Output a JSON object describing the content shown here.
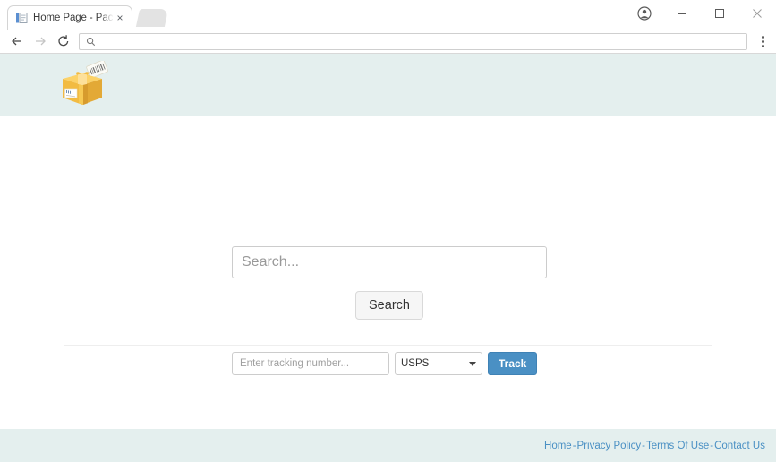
{
  "browser": {
    "tabs": [
      {
        "title": "Home Page - Package Tr",
        "favicon": "page-icon",
        "close_label": "×"
      }
    ],
    "new_tab_label": "",
    "window_controls": {
      "profile": "profile-icon",
      "minimize": "–",
      "maximize": "□",
      "close": "×"
    },
    "toolbar": {
      "back": "back-arrow-icon",
      "forward": "forward-arrow-icon",
      "reload": "reload-icon",
      "omnibox_icon": "search-icon",
      "omnibox_value": "",
      "omnibox_placeholder": "",
      "menu": "three-dot-menu-icon"
    }
  },
  "page": {
    "header": {
      "logo_alt": "package-box-logo"
    },
    "search": {
      "placeholder": "Search...",
      "value": "",
      "button_label": "Search"
    },
    "tracking": {
      "placeholder": "Enter tracking number...",
      "value": "",
      "carrier_selected": "USPS",
      "carrier_options": [
        "USPS"
      ],
      "button_label": "Track"
    },
    "footer": {
      "links": [
        {
          "label": "Home"
        },
        {
          "label": "Privacy Policy"
        },
        {
          "label": "Terms Of Use"
        },
        {
          "label": "Contact Us"
        }
      ],
      "separator": "-"
    }
  },
  "colors": {
    "band": "#e4efee",
    "accent_blue": "#4a90c4",
    "text": "#333333",
    "placeholder": "#999999"
  }
}
